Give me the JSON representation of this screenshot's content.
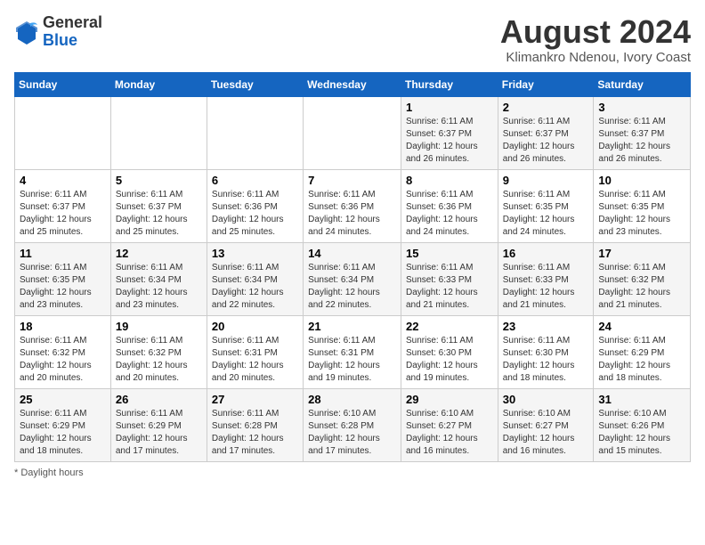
{
  "logo": {
    "general": "General",
    "blue": "Blue"
  },
  "title": {
    "month_year": "August 2024",
    "location": "Klimankro Ndenou, Ivory Coast"
  },
  "days_of_week": [
    "Sunday",
    "Monday",
    "Tuesday",
    "Wednesday",
    "Thursday",
    "Friday",
    "Saturday"
  ],
  "footer": {
    "daylight_hours": "Daylight hours"
  },
  "weeks": [
    [
      {
        "day": "",
        "detail": ""
      },
      {
        "day": "",
        "detail": ""
      },
      {
        "day": "",
        "detail": ""
      },
      {
        "day": "",
        "detail": ""
      },
      {
        "day": "1",
        "detail": "Sunrise: 6:11 AM\nSunset: 6:37 PM\nDaylight: 12 hours\nand 26 minutes."
      },
      {
        "day": "2",
        "detail": "Sunrise: 6:11 AM\nSunset: 6:37 PM\nDaylight: 12 hours\nand 26 minutes."
      },
      {
        "day": "3",
        "detail": "Sunrise: 6:11 AM\nSunset: 6:37 PM\nDaylight: 12 hours\nand 26 minutes."
      }
    ],
    [
      {
        "day": "4",
        "detail": "Sunrise: 6:11 AM\nSunset: 6:37 PM\nDaylight: 12 hours\nand 25 minutes."
      },
      {
        "day": "5",
        "detail": "Sunrise: 6:11 AM\nSunset: 6:37 PM\nDaylight: 12 hours\nand 25 minutes."
      },
      {
        "day": "6",
        "detail": "Sunrise: 6:11 AM\nSunset: 6:36 PM\nDaylight: 12 hours\nand 25 minutes."
      },
      {
        "day": "7",
        "detail": "Sunrise: 6:11 AM\nSunset: 6:36 PM\nDaylight: 12 hours\nand 24 minutes."
      },
      {
        "day": "8",
        "detail": "Sunrise: 6:11 AM\nSunset: 6:36 PM\nDaylight: 12 hours\nand 24 minutes."
      },
      {
        "day": "9",
        "detail": "Sunrise: 6:11 AM\nSunset: 6:35 PM\nDaylight: 12 hours\nand 24 minutes."
      },
      {
        "day": "10",
        "detail": "Sunrise: 6:11 AM\nSunset: 6:35 PM\nDaylight: 12 hours\nand 23 minutes."
      }
    ],
    [
      {
        "day": "11",
        "detail": "Sunrise: 6:11 AM\nSunset: 6:35 PM\nDaylight: 12 hours\nand 23 minutes."
      },
      {
        "day": "12",
        "detail": "Sunrise: 6:11 AM\nSunset: 6:34 PM\nDaylight: 12 hours\nand 23 minutes."
      },
      {
        "day": "13",
        "detail": "Sunrise: 6:11 AM\nSunset: 6:34 PM\nDaylight: 12 hours\nand 22 minutes."
      },
      {
        "day": "14",
        "detail": "Sunrise: 6:11 AM\nSunset: 6:34 PM\nDaylight: 12 hours\nand 22 minutes."
      },
      {
        "day": "15",
        "detail": "Sunrise: 6:11 AM\nSunset: 6:33 PM\nDaylight: 12 hours\nand 21 minutes."
      },
      {
        "day": "16",
        "detail": "Sunrise: 6:11 AM\nSunset: 6:33 PM\nDaylight: 12 hours\nand 21 minutes."
      },
      {
        "day": "17",
        "detail": "Sunrise: 6:11 AM\nSunset: 6:32 PM\nDaylight: 12 hours\nand 21 minutes."
      }
    ],
    [
      {
        "day": "18",
        "detail": "Sunrise: 6:11 AM\nSunset: 6:32 PM\nDaylight: 12 hours\nand 20 minutes."
      },
      {
        "day": "19",
        "detail": "Sunrise: 6:11 AM\nSunset: 6:32 PM\nDaylight: 12 hours\nand 20 minutes."
      },
      {
        "day": "20",
        "detail": "Sunrise: 6:11 AM\nSunset: 6:31 PM\nDaylight: 12 hours\nand 20 minutes."
      },
      {
        "day": "21",
        "detail": "Sunrise: 6:11 AM\nSunset: 6:31 PM\nDaylight: 12 hours\nand 19 minutes."
      },
      {
        "day": "22",
        "detail": "Sunrise: 6:11 AM\nSunset: 6:30 PM\nDaylight: 12 hours\nand 19 minutes."
      },
      {
        "day": "23",
        "detail": "Sunrise: 6:11 AM\nSunset: 6:30 PM\nDaylight: 12 hours\nand 18 minutes."
      },
      {
        "day": "24",
        "detail": "Sunrise: 6:11 AM\nSunset: 6:29 PM\nDaylight: 12 hours\nand 18 minutes."
      }
    ],
    [
      {
        "day": "25",
        "detail": "Sunrise: 6:11 AM\nSunset: 6:29 PM\nDaylight: 12 hours\nand 18 minutes."
      },
      {
        "day": "26",
        "detail": "Sunrise: 6:11 AM\nSunset: 6:29 PM\nDaylight: 12 hours\nand 17 minutes."
      },
      {
        "day": "27",
        "detail": "Sunrise: 6:11 AM\nSunset: 6:28 PM\nDaylight: 12 hours\nand 17 minutes."
      },
      {
        "day": "28",
        "detail": "Sunrise: 6:10 AM\nSunset: 6:28 PM\nDaylight: 12 hours\nand 17 minutes."
      },
      {
        "day": "29",
        "detail": "Sunrise: 6:10 AM\nSunset: 6:27 PM\nDaylight: 12 hours\nand 16 minutes."
      },
      {
        "day": "30",
        "detail": "Sunrise: 6:10 AM\nSunset: 6:27 PM\nDaylight: 12 hours\nand 16 minutes."
      },
      {
        "day": "31",
        "detail": "Sunrise: 6:10 AM\nSunset: 6:26 PM\nDaylight: 12 hours\nand 15 minutes."
      }
    ]
  ]
}
